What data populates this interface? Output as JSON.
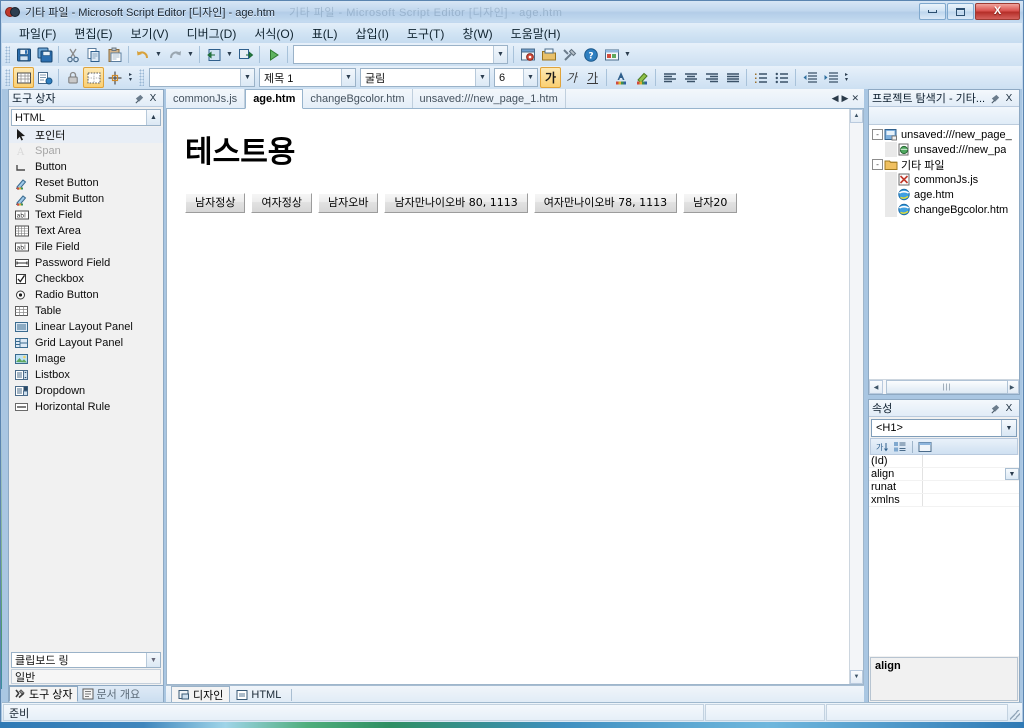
{
  "window": {
    "title": "기타 파일 - Microsoft Script Editor [디자인] - age.htm",
    "ghost_title": "기타 파일 - Microsoft Script Editor [디자인] - age.htm",
    "minimize_label": "최소화",
    "maximize_label": "최대화",
    "close_label": "X"
  },
  "menubar": {
    "items": [
      {
        "label": "파일(F)"
      },
      {
        "label": "편집(E)"
      },
      {
        "label": "보기(V)"
      },
      {
        "label": "디버그(D)"
      },
      {
        "label": "서식(O)"
      },
      {
        "label": "표(L)"
      },
      {
        "label": "삽입(I)"
      },
      {
        "label": "도구(T)"
      },
      {
        "label": "창(W)"
      },
      {
        "label": "도움말(H)"
      }
    ]
  },
  "toolbar_standard": {
    "buttons": [
      {
        "name": "save-icon",
        "glyph": "save"
      },
      {
        "name": "save-all-icon",
        "glyph": "saveall"
      },
      {
        "name": "cut-icon",
        "glyph": "cut"
      },
      {
        "name": "copy-icon",
        "glyph": "copy"
      },
      {
        "name": "paste-icon",
        "glyph": "paste"
      },
      {
        "name": "undo-icon",
        "glyph": "undo"
      },
      {
        "name": "redo-icon",
        "glyph": "redo"
      },
      {
        "name": "navigate-icon",
        "glyph": "nav"
      },
      {
        "name": "new-window-icon",
        "glyph": "newwin"
      },
      {
        "name": "start-debug-icon",
        "glyph": "play"
      }
    ],
    "find_value": "",
    "find_placeholder": "",
    "right_buttons": [
      {
        "name": "properties-window-icon",
        "glyph": "propwin"
      },
      {
        "name": "project-explorer-icon",
        "glyph": "projexp"
      },
      {
        "name": "tools-icon",
        "glyph": "tools"
      },
      {
        "name": "help-icon",
        "glyph": "help"
      },
      {
        "name": "toolbox-icon",
        "glyph": "toolboxwin"
      }
    ]
  },
  "toolbar_format": {
    "left_buttons": [
      {
        "name": "table-grid-icon",
        "glyph": "tablegrid",
        "active": true
      },
      {
        "name": "show-details-icon",
        "glyph": "details",
        "active": false
      },
      {
        "name": "lock-icon",
        "glyph": "lock",
        "active": false
      },
      {
        "name": "show-borders-icon",
        "glyph": "borders",
        "active": true
      },
      {
        "name": "absolute-position-icon",
        "glyph": "abspos",
        "active": false
      }
    ],
    "style_value": "",
    "block_format_value": "제목 1",
    "font_family_value": "굴림",
    "font_size_value": "6",
    "bold_label": "가",
    "italic_label": "가",
    "underline_label": "가",
    "font_color_label": "A",
    "highlight_label": "A",
    "align_buttons": [
      "왼쪽 맞춤",
      "가운데 맞춤",
      "오른쪽 맞춤",
      "양쪽 맞춤"
    ],
    "list_buttons": [
      "번호 매기기",
      "글머리 기호"
    ],
    "indent_buttons": [
      "내어쓰기",
      "들여쓰기"
    ]
  },
  "toolbox": {
    "title": "도구 상자",
    "pin_label": "고정",
    "close_label": "X",
    "category_value": "HTML",
    "items": [
      {
        "label": "포인터",
        "icon": "pointer-icon",
        "selected": true,
        "disabled": false
      },
      {
        "label": "Span",
        "icon": "span-icon",
        "selected": false,
        "disabled": true
      },
      {
        "label": "Button",
        "icon": "button-icon",
        "selected": false,
        "disabled": false
      },
      {
        "label": "Reset Button",
        "icon": "reset-button-icon",
        "selected": false,
        "disabled": false
      },
      {
        "label": "Submit Button",
        "icon": "submit-button-icon",
        "selected": false,
        "disabled": false
      },
      {
        "label": "Text Field",
        "icon": "text-field-icon",
        "selected": false,
        "disabled": false
      },
      {
        "label": "Text Area",
        "icon": "text-area-icon",
        "selected": false,
        "disabled": false
      },
      {
        "label": "File Field",
        "icon": "file-field-icon",
        "selected": false,
        "disabled": false
      },
      {
        "label": "Password Field",
        "icon": "password-field-icon",
        "selected": false,
        "disabled": false
      },
      {
        "label": "Checkbox",
        "icon": "checkbox-icon",
        "selected": false,
        "disabled": false
      },
      {
        "label": "Radio Button",
        "icon": "radio-button-icon",
        "selected": false,
        "disabled": false
      },
      {
        "label": "Table",
        "icon": "table-icon",
        "selected": false,
        "disabled": false
      },
      {
        "label": "Linear Layout Panel",
        "icon": "linear-layout-panel-icon",
        "selected": false,
        "disabled": false
      },
      {
        "label": "Grid Layout Panel",
        "icon": "grid-layout-panel-icon",
        "selected": false,
        "disabled": false
      },
      {
        "label": "Image",
        "icon": "image-icon",
        "selected": false,
        "disabled": false
      },
      {
        "label": "Listbox",
        "icon": "listbox-icon",
        "selected": false,
        "disabled": false
      },
      {
        "label": "Dropdown",
        "icon": "dropdown-icon",
        "selected": false,
        "disabled": false
      },
      {
        "label": "Horizontal Rule",
        "icon": "horizontal-rule-icon",
        "selected": false,
        "disabled": false
      }
    ],
    "clipboard_ring_label": "클립보드 링",
    "general_label": "일반",
    "dock_tabs": [
      {
        "label": "도구 상자",
        "icon": "toolbox-icon",
        "active": true
      },
      {
        "label": "문서 개요",
        "icon": "document-outline-icon",
        "active": false
      }
    ]
  },
  "editor": {
    "document_tabs": [
      {
        "label": "commonJs.js",
        "active": false
      },
      {
        "label": "age.htm",
        "active": true
      },
      {
        "label": "changeBgcolor.htm",
        "active": false
      },
      {
        "label": "unsaved:///new_page_1.htm",
        "active": false
      }
    ],
    "tab_prev_label": "◀",
    "tab_next_label": "▶",
    "tab_close_label": "✕",
    "page": {
      "heading": "테스트용",
      "buttons": [
        {
          "label": "남자정상"
        },
        {
          "label": "여자정상"
        },
        {
          "label": "남자오바"
        },
        {
          "label": "남자만나이오바 80, 1113"
        },
        {
          "label": "여자만나이오바 78, 1113"
        },
        {
          "label": "남자20"
        }
      ]
    },
    "view_tabs": [
      {
        "label": "디자인",
        "icon": "design-view-icon",
        "active": true
      },
      {
        "label": "HTML",
        "icon": "html-view-icon",
        "active": false
      }
    ]
  },
  "project_explorer": {
    "title": "프로젝트 탐색기 - 기타...",
    "pin_label": "고정",
    "close_label": "X",
    "tree": [
      {
        "label": "unsaved:///new_page_",
        "icon": "project-icon",
        "depth": 0,
        "expander": "-"
      },
      {
        "label": "unsaved:///new_pa",
        "icon": "html-page-icon",
        "depth": 1,
        "expander": ""
      },
      {
        "label": "기타 파일",
        "icon": "folder-icon",
        "depth": 0,
        "expander": "-"
      },
      {
        "label": "commonJs.js",
        "icon": "js-file-icon",
        "depth": 1,
        "expander": ""
      },
      {
        "label": "age.htm",
        "icon": "html-file-icon",
        "depth": 1,
        "expander": ""
      },
      {
        "label": "changeBgcolor.htm",
        "icon": "html-file-icon",
        "depth": 1,
        "expander": ""
      }
    ],
    "scroll_left_label": "◀",
    "scroll_right_label": "▶"
  },
  "properties": {
    "title": "속성",
    "pin_label": "고정",
    "close_label": "X",
    "object_value": "<H1>",
    "toolbar_buttons": [
      {
        "name": "sort-alphabetical-icon",
        "label": "가↓"
      },
      {
        "name": "categorized-icon",
        "label": "범주"
      },
      {
        "name": "property-pages-icon",
        "label": "페이지"
      }
    ],
    "rows": [
      {
        "name": "(Id)",
        "value": "",
        "has_dropdown": false
      },
      {
        "name": "align",
        "value": "",
        "has_dropdown": true
      },
      {
        "name": "runat",
        "value": "",
        "has_dropdown": false
      },
      {
        "name": "xmlns",
        "value": "",
        "has_dropdown": false
      }
    ],
    "description": "align"
  },
  "statusbar": {
    "message": "준비",
    "cell_b": "",
    "cell_c": ""
  }
}
